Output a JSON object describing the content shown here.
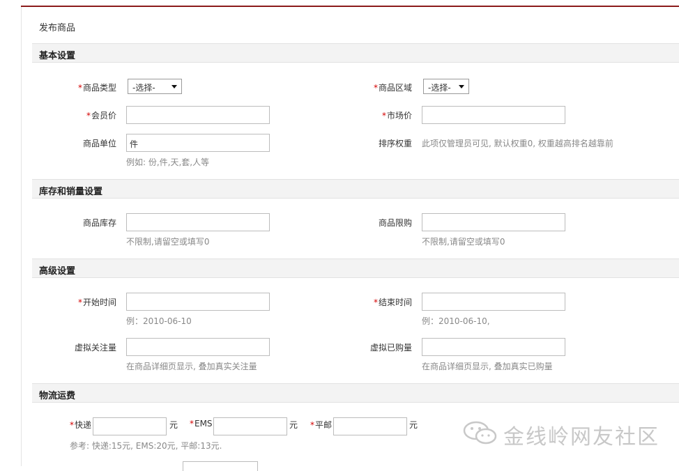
{
  "page": {
    "title": "发布商品"
  },
  "sections": {
    "basic": "基本设置",
    "stock": "库存和销量设置",
    "advanced": "高级设置",
    "shipping": "物流运费"
  },
  "basic": {
    "type_label": "商品类型",
    "type_value": "-选择-",
    "region_label": "商品区域",
    "region_value": "-选择-",
    "member_price_label": "会员价",
    "member_price_value": "",
    "market_price_label": "市场价",
    "market_price_value": "",
    "unit_label": "商品单位",
    "unit_value": "件",
    "unit_hint": "例如: 份,件,天,套,人等",
    "sort_label": "排序权重",
    "sort_hint": "此项仅管理员可见, 默认权重0, 权重越高排名越靠前"
  },
  "stock": {
    "stock_label": "商品库存",
    "stock_value": "",
    "stock_hint": "不限制,请留空或填写0",
    "limit_label": "商品限购",
    "limit_value": "",
    "limit_hint": "不限制,请留空或填写0"
  },
  "advanced": {
    "start_label": "开始时间",
    "start_value": "",
    "start_hint": "例：2010-06-10",
    "end_label": "结束时间",
    "end_value": "",
    "end_hint": "例：2010-06-10,",
    "follow_label": "虚拟关注量",
    "follow_value": "",
    "follow_hint": "在商品详细页显示, 叠加真实关注量",
    "bought_label": "虚拟已购量",
    "bought_value": "",
    "bought_hint": "在商品详细页显示, 叠加真实已购量"
  },
  "shipping": {
    "express_label": "快递",
    "ems_label": "EMS",
    "post_label": "平邮",
    "currency": "元",
    "hint": "参考: 快递:15元, EMS:20元, 平邮:13元."
  },
  "watermark": {
    "text": "金线岭网友社区"
  },
  "required_mark": "*"
}
